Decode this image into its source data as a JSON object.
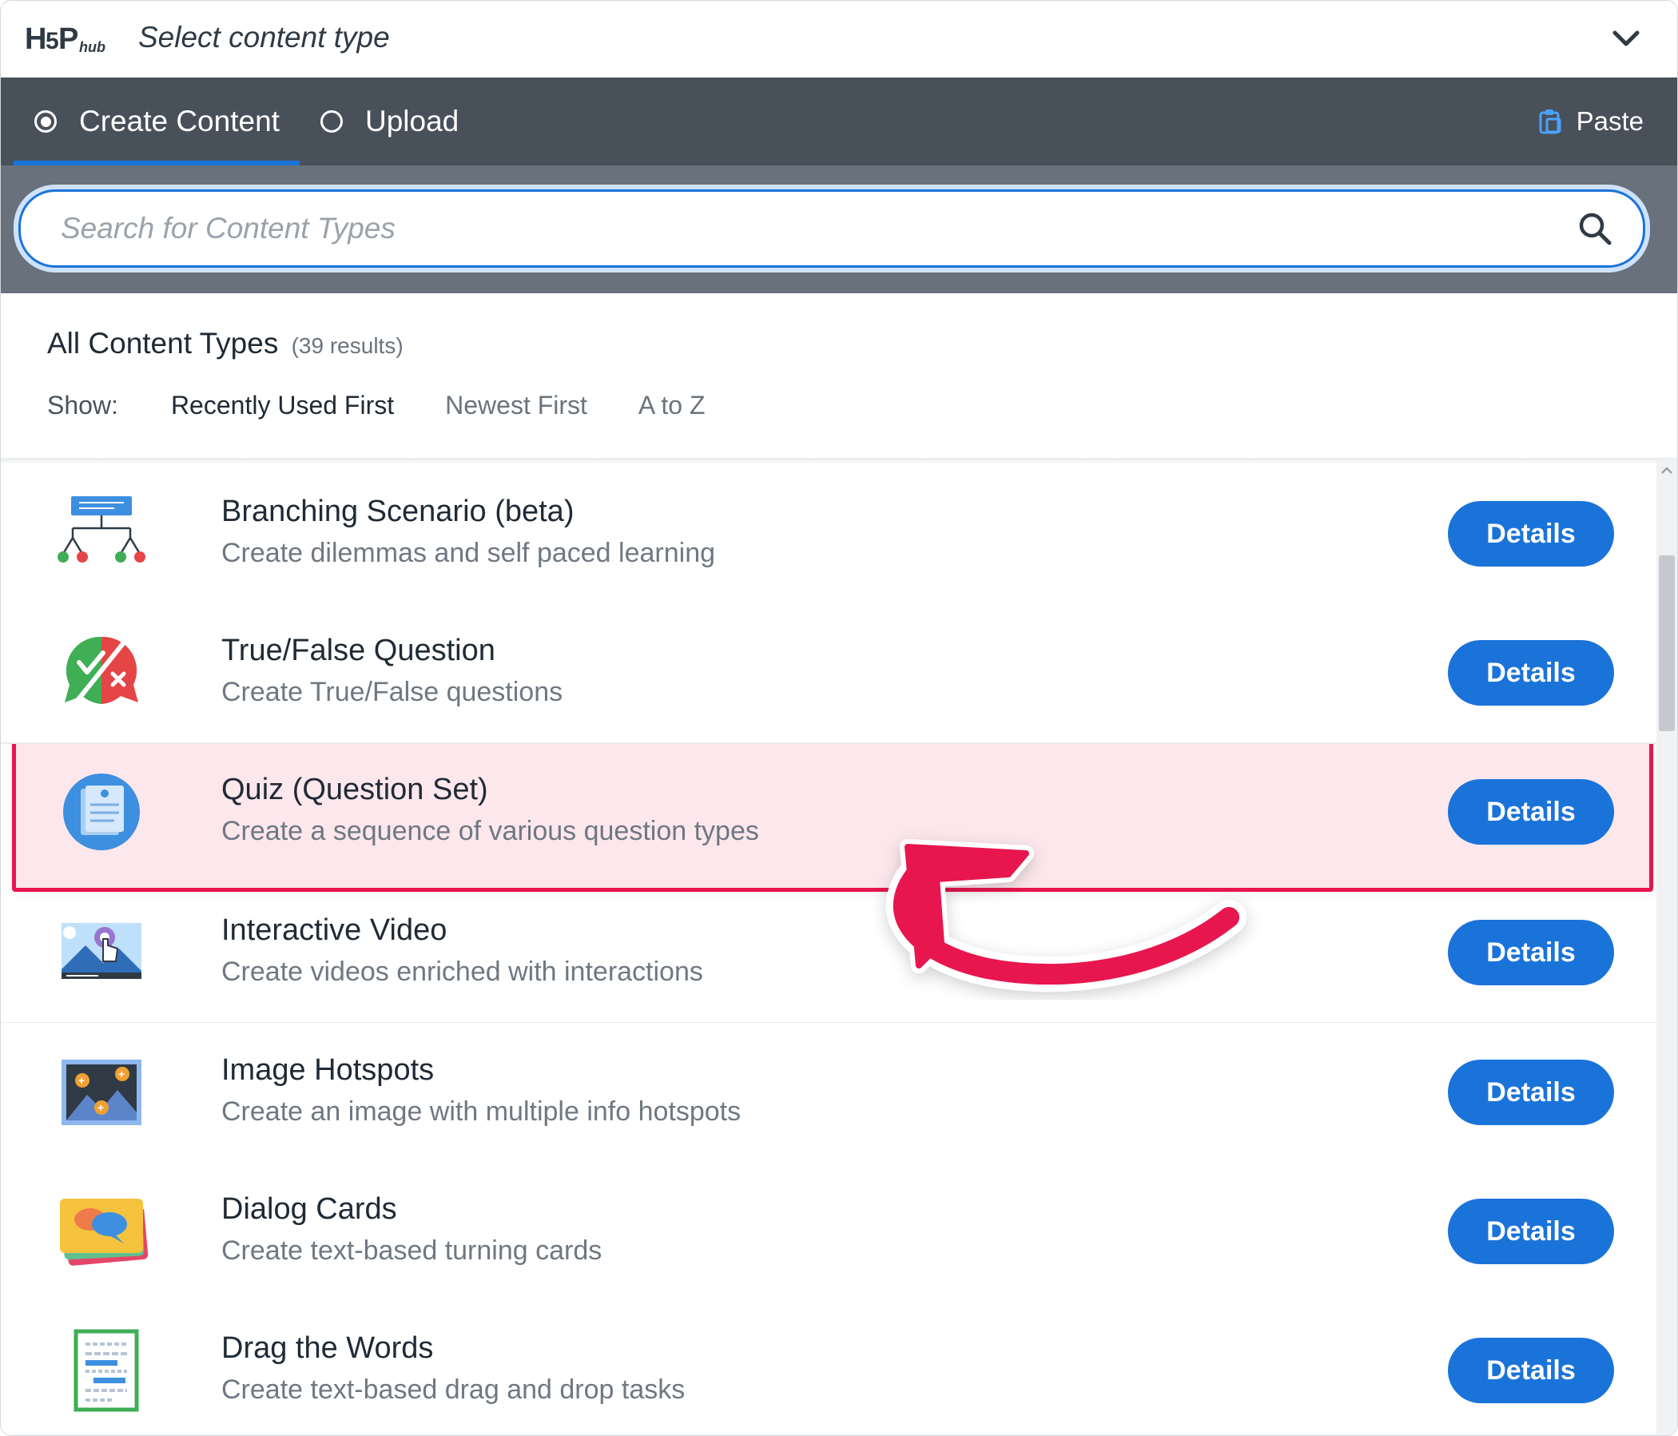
{
  "header": {
    "logo_text": "H5P hub",
    "title": "Select content type"
  },
  "tabs": [
    {
      "label": "Create Content",
      "selected": true
    },
    {
      "label": "Upload",
      "selected": false
    }
  ],
  "paste_label": "Paste",
  "search": {
    "placeholder": "Search for Content Types",
    "value": ""
  },
  "list": {
    "title": "All Content Types",
    "count": "(39 results)",
    "show_label": "Show:",
    "sort_options": [
      "Recently Used First",
      "Newest First",
      "A to Z"
    ],
    "active_sort": "Recently Used First"
  },
  "items": [
    {
      "title": "Branching Scenario (beta)",
      "desc": "Create dilemmas and self paced learning",
      "icon": "branching-scenario-icon",
      "button": "Details"
    },
    {
      "title": "True/False Question",
      "desc": "Create True/False questions",
      "icon": "true-false-icon",
      "button": "Details"
    },
    {
      "title": "Quiz (Question Set)",
      "desc": "Create a sequence of various question types",
      "icon": "question-set-icon",
      "button": "Details",
      "highlighted": true
    },
    {
      "title": "Interactive Video",
      "desc": "Create videos enriched with interactions",
      "icon": "interactive-video-icon",
      "button": "Details"
    },
    {
      "title": "Image Hotspots",
      "desc": "Create an image with multiple info hotspots",
      "icon": "image-hotspots-icon",
      "button": "Details"
    },
    {
      "title": "Dialog Cards",
      "desc": "Create text-based turning cards",
      "icon": "dialog-cards-icon",
      "button": "Details"
    },
    {
      "title": "Drag the Words",
      "desc": "Create text-based drag and drop tasks",
      "icon": "drag-the-words-icon",
      "button": "Details"
    }
  ],
  "colors": {
    "accent": "#1a73d9",
    "tab_bar": "#48505a",
    "search_bar": "#68717c",
    "highlight_border": "#e8154f",
    "highlight_fill": "#fce7ec"
  }
}
